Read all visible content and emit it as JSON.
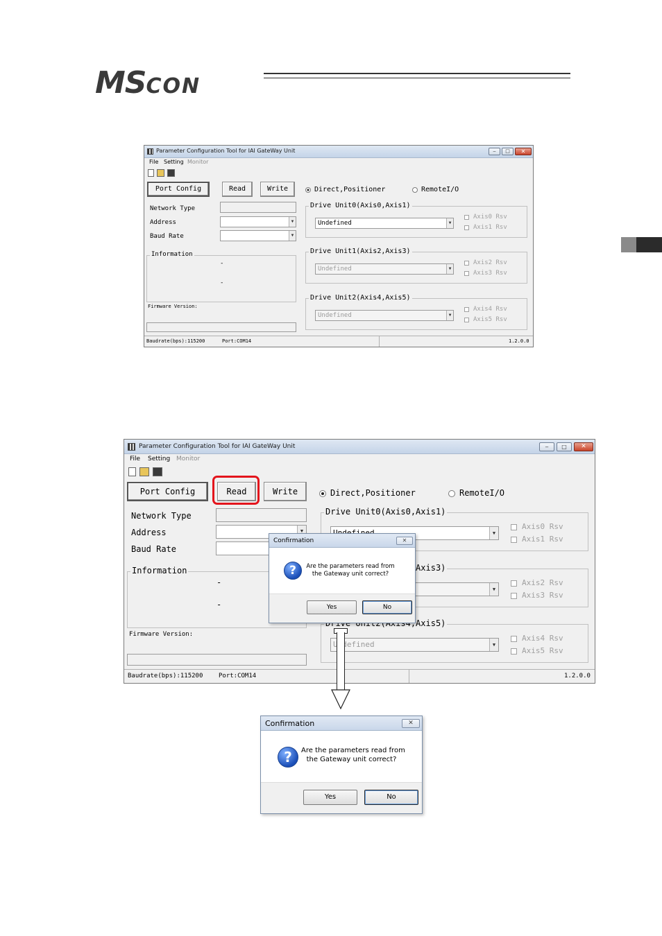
{
  "header": {
    "logo_main": "MS",
    "logo_sub": "CON"
  },
  "app": {
    "title": "Parameter Configuration Tool for IAI GateWay Unit",
    "menu": {
      "file": "File",
      "setting": "Setting",
      "monitor": "Monitor"
    },
    "buttons": {
      "port_config": "Port Config",
      "read": "Read",
      "write": "Write"
    },
    "mode": {
      "direct": "Direct,Positioner",
      "remote": "RemoteI/O"
    },
    "labels": {
      "network_type": "Network Type",
      "address": "Address",
      "baud_rate": "Baud Rate"
    },
    "information": {
      "title": "Information",
      "line1": "-",
      "line2": "-"
    },
    "firmware_label": "Firmware Version:",
    "drive_units": [
      {
        "title": "Drive Unit0(Axis0,Axis1)",
        "value": "Undefined",
        "axis_a": "Axis0 Rsv",
        "axis_b": "Axis1 Rsv"
      },
      {
        "title": "Drive Unit1(Axis2,Axis3)",
        "value": "Undefined",
        "axis_a": "Axis2 Rsv",
        "axis_b": "Axis3 Rsv"
      },
      {
        "title": "Drive Unit2(Axis4,Axis5)",
        "value": "Undefined",
        "axis_a": "Axis4 Rsv",
        "axis_b": "Axis5 Rsv"
      }
    ],
    "status": {
      "baud": "Baudrate(bps):115200",
      "port_small": "Port:COM14",
      "port": "Port:COM14",
      "version": "1.2.0.0"
    }
  },
  "dialog": {
    "title": "Confirmation",
    "line1": "Are the parameters read from",
    "line2": "the Gateway unit correct?",
    "yes": "Yes",
    "no": "No"
  }
}
